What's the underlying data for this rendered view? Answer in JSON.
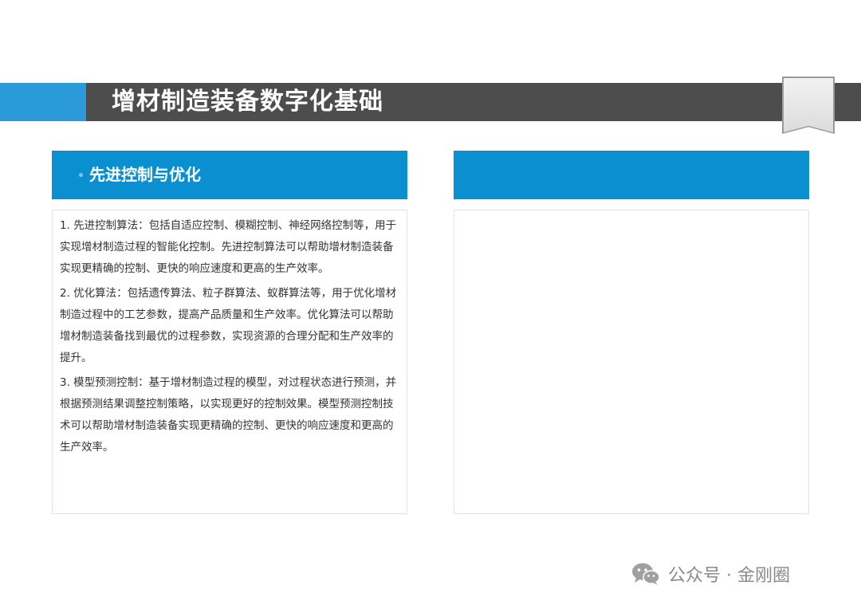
{
  "header": {
    "title": "增材制造装备数字化基础"
  },
  "left_panel": {
    "title": "先进控制与优化",
    "paragraphs": [
      "1. 先进控制算法：包括自适应控制、模糊控制、神经网络控制等，用于实现增材制造过程的智能化控制。先进控制算法可以帮助增材制造装备实现更精确的控制、更快的响应速度和更高的生产效率。",
      "2. 优化算法：包括遗传算法、粒子群算法、蚁群算法等，用于优化增材制造过程中的工艺参数，提高产品质量和生产效率。优化算法可以帮助增材制造装备找到最优的过程参数，实现资源的合理分配和生产效率的提升。",
      "3. 模型预测控制：基于增材制造过程的模型，对过程状态进行预测，并根据预测结果调整控制策略，以实现更好的控制效果。模型预测控制技术可以帮助增材制造装备实现更精确的控制、更快的响应速度和更高的生产效率。"
    ]
  },
  "watermark": {
    "text": "公众号 · 金刚圈"
  },
  "colors": {
    "title_bar": "#4d4d4d",
    "title_accent": "#2a9bd8",
    "panel_header": "#0a8fd0"
  }
}
